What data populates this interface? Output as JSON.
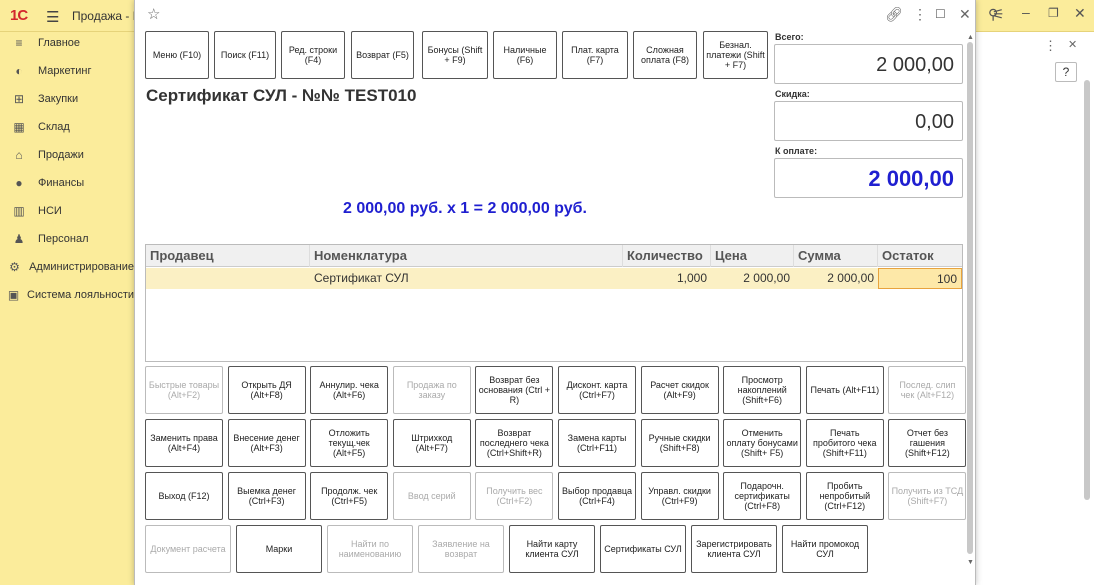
{
  "topbar": {
    "logo": "1С",
    "title": "Продажа - И",
    "icons": [
      "menu-icon",
      "bell-icon",
      "history-icon",
      "star-icon",
      "search-icon",
      "settings-icon",
      "minimize-icon",
      "restore-icon",
      "close-icon"
    ]
  },
  "sidebar": {
    "items": [
      {
        "label": "Главное",
        "icon": "≡"
      },
      {
        "label": "Маркетинг",
        "icon": "◐"
      },
      {
        "label": "Закупки",
        "icon": "⊞"
      },
      {
        "label": "Склад",
        "icon": "▦"
      },
      {
        "label": "Продажи",
        "icon": "⌂"
      },
      {
        "label": "Финансы",
        "icon": "●"
      },
      {
        "label": "НСИ",
        "icon": "▥"
      },
      {
        "label": "Персонал",
        "icon": "♟"
      },
      {
        "label": "Администрирование",
        "icon": "⚙"
      },
      {
        "label": "Система лояльности",
        "icon": "▣"
      }
    ]
  },
  "rightbg": {
    "help_label": "?"
  },
  "window": {
    "toolbar": [
      "Меню (F10)",
      "Поиск (F11)",
      "Ред. строки (F4)",
      "Возврат (F5)",
      "Бонусы (Shift + F9)",
      "Наличные (F6)",
      "Плат. карта (F7)",
      "Сложная оплата (F8)",
      "Безнал. платежи (Shift + F7)"
    ],
    "product_title": "Сертификат СУЛ - №№ TEST010",
    "calculation": "2 000,00 руб. x 1  = 2 000,00 руб.",
    "totals": {
      "total_label": "Всего:",
      "total_value": "2 000,00",
      "discount_label": "Скидка:",
      "discount_value": "0,00",
      "pay_label": "К оплате:",
      "pay_value": "2 000,00",
      "pay_color": "#1f1fd0"
    },
    "table": {
      "columns": [
        "Продавец",
        "Номенклатура",
        "Количество",
        "Цена",
        "Сумма",
        "Остаток"
      ],
      "rows": [
        {
          "seller": "",
          "item": "Сертификат СУЛ",
          "qty": "1,000",
          "price": "2 000,00",
          "sum": "2 000,00",
          "stock": "100"
        }
      ]
    },
    "actions": [
      [
        {
          "label": "Быстрые товары (Alt+F2)",
          "enabled": false
        },
        {
          "label": "Открыть ДЯ (Alt+F8)",
          "enabled": true
        },
        {
          "label": "Аннулир. чека (Alt+F6)",
          "enabled": true
        },
        {
          "label": "Продажа по заказу",
          "enabled": false
        },
        {
          "label": "Возврат без основания (Ctrl + R)",
          "enabled": true
        },
        {
          "label": "Дисконт. карта (Ctrl+F7)",
          "enabled": true
        },
        {
          "label": "Расчет скидок (Alt+F9)",
          "enabled": true
        },
        {
          "label": "Просмотр накоплений (Shift+F6)",
          "enabled": true
        },
        {
          "label": "Печать (Alt+F11)",
          "enabled": true
        },
        {
          "label": "Послед. слип чек (Alt+F12)",
          "enabled": false
        }
      ],
      [
        {
          "label": "Заменить права (Alt+F4)",
          "enabled": true
        },
        {
          "label": "Внесение денег (Alt+F3)",
          "enabled": true
        },
        {
          "label": "Отложить текущ.чек (Alt+F5)",
          "enabled": true
        },
        {
          "label": "Штрихкод (Alt+F7)",
          "enabled": true
        },
        {
          "label": "Возврат последнего чека (Ctrl+Shift+R)",
          "enabled": true
        },
        {
          "label": "Замена карты (Ctrl+F11)",
          "enabled": true
        },
        {
          "label": "Ручные скидки (Shift+F8)",
          "enabled": true
        },
        {
          "label": "Отменить оплату бонусами (Shift+ F5)",
          "enabled": true
        },
        {
          "label": "Печать пробитого чека (Shift+F11)",
          "enabled": true
        },
        {
          "label": "Отчет без гашения (Shift+F12)",
          "enabled": true
        }
      ],
      [
        {
          "label": "Выход (F12)",
          "enabled": true
        },
        {
          "label": "Выемка денег (Ctrl+F3)",
          "enabled": true
        },
        {
          "label": "Продолж. чек (Ctrl+F5)",
          "enabled": true
        },
        {
          "label": "Ввод серий",
          "enabled": false
        },
        {
          "label": "Получить вес (Ctrl+F2)",
          "enabled": false
        },
        {
          "label": "Выбор продавца (Ctrl+F4)",
          "enabled": true
        },
        {
          "label": "Управл. скидки (Ctrl+F9)",
          "enabled": true
        },
        {
          "label": "Подарочн. сертификаты (Ctrl+F8)",
          "enabled": true
        },
        {
          "label": "Пробить непробитый (Ctrl+F12)",
          "enabled": true
        },
        {
          "label": "Получить из ТСД (Shift+F7)",
          "enabled": false
        }
      ],
      [
        {
          "label": "Документ расчета",
          "enabled": false
        },
        {
          "label": "Марки",
          "enabled": true
        },
        {
          "label": "Найти по наименованию",
          "enabled": false
        },
        {
          "label": "Заявление на возврат",
          "enabled": false
        },
        {
          "label": "Найти карту клиента СУЛ",
          "enabled": true
        },
        {
          "label": "Сертификаты СУЛ",
          "enabled": true
        },
        {
          "label": "Зарегистрировать клиента СУЛ",
          "enabled": true
        },
        {
          "label": "Найти промокод СУЛ",
          "enabled": true
        }
      ]
    ]
  }
}
